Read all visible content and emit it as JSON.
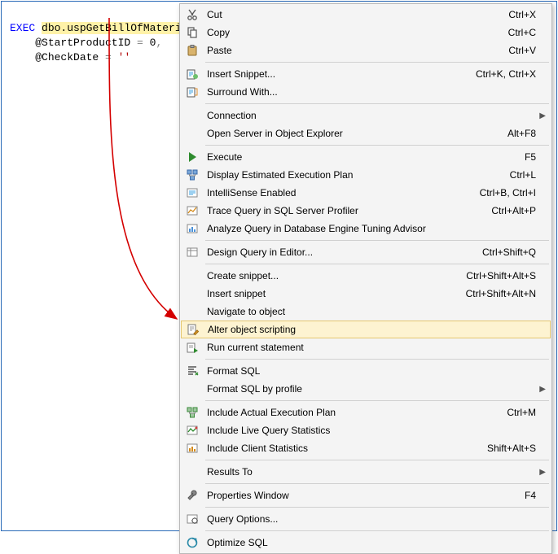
{
  "editor": {
    "exec_keyword": "EXEC",
    "proc_name": "dbo.uspGetBillOfMaterials",
    "param1_name": "@StartProductID",
    "param1_eq": " = ",
    "param1_val": "0",
    "comma": ",",
    "param2_name": "@CheckDate",
    "param2_eq": " = ",
    "param2_val": "''"
  },
  "menu": {
    "items": [
      {
        "icon": "cut-icon",
        "label": "Cut",
        "shortcut": "Ctrl+X"
      },
      {
        "icon": "copy-icon",
        "label": "Copy",
        "shortcut": "Ctrl+C"
      },
      {
        "icon": "paste-icon",
        "label": "Paste",
        "shortcut": "Ctrl+V"
      },
      {
        "sep": true
      },
      {
        "icon": "snippet-icon",
        "label": "Insert Snippet...",
        "shortcut": "Ctrl+K, Ctrl+X"
      },
      {
        "icon": "surround-icon",
        "label": "Surround With..."
      },
      {
        "sep": true
      },
      {
        "icon": "",
        "label": "Connection",
        "sub": true
      },
      {
        "icon": "",
        "label": "Open Server in Object Explorer",
        "shortcut": "Alt+F8"
      },
      {
        "sep": true
      },
      {
        "icon": "execute-icon",
        "label": "Execute",
        "shortcut": "F5"
      },
      {
        "icon": "plan-icon",
        "label": "Display Estimated Execution Plan",
        "shortcut": "Ctrl+L"
      },
      {
        "icon": "intellisense-icon",
        "label": "IntelliSense Enabled",
        "shortcut": "Ctrl+B, Ctrl+I"
      },
      {
        "icon": "trace-icon",
        "label": "Trace Query in SQL Server Profiler",
        "shortcut": "Ctrl+Alt+P"
      },
      {
        "icon": "analyze-icon",
        "label": "Analyze Query in Database Engine Tuning Advisor"
      },
      {
        "sep": true
      },
      {
        "icon": "design-icon",
        "label": "Design Query in Editor...",
        "shortcut": "Ctrl+Shift+Q"
      },
      {
        "sep": true
      },
      {
        "icon": "",
        "label": "Create snippet...",
        "shortcut": "Ctrl+Shift+Alt+S"
      },
      {
        "icon": "",
        "label": "Insert snippet",
        "shortcut": "Ctrl+Shift+Alt+N"
      },
      {
        "icon": "",
        "label": "Navigate to object"
      },
      {
        "icon": "alter-icon",
        "label": "Alter object scripting",
        "hover": true
      },
      {
        "icon": "run-icon",
        "label": "Run current statement"
      },
      {
        "sep": true
      },
      {
        "icon": "format-icon",
        "label": "Format SQL"
      },
      {
        "icon": "",
        "label": "Format SQL by profile",
        "sub": true
      },
      {
        "sep": true
      },
      {
        "icon": "actualplan-icon",
        "label": "Include Actual Execution Plan",
        "shortcut": "Ctrl+M"
      },
      {
        "icon": "livestats-icon",
        "label": "Include Live Query Statistics"
      },
      {
        "icon": "clientstats-icon",
        "label": "Include Client Statistics",
        "shortcut": "Shift+Alt+S"
      },
      {
        "sep": true
      },
      {
        "icon": "",
        "label": "Results To",
        "sub": true
      },
      {
        "sep": true
      },
      {
        "icon": "properties-icon",
        "label": "Properties Window",
        "shortcut": "F4"
      },
      {
        "sep": true
      },
      {
        "icon": "options-icon",
        "label": "Query Options..."
      },
      {
        "sep": true
      },
      {
        "icon": "optimize-icon",
        "label": "Optimize SQL"
      }
    ]
  }
}
